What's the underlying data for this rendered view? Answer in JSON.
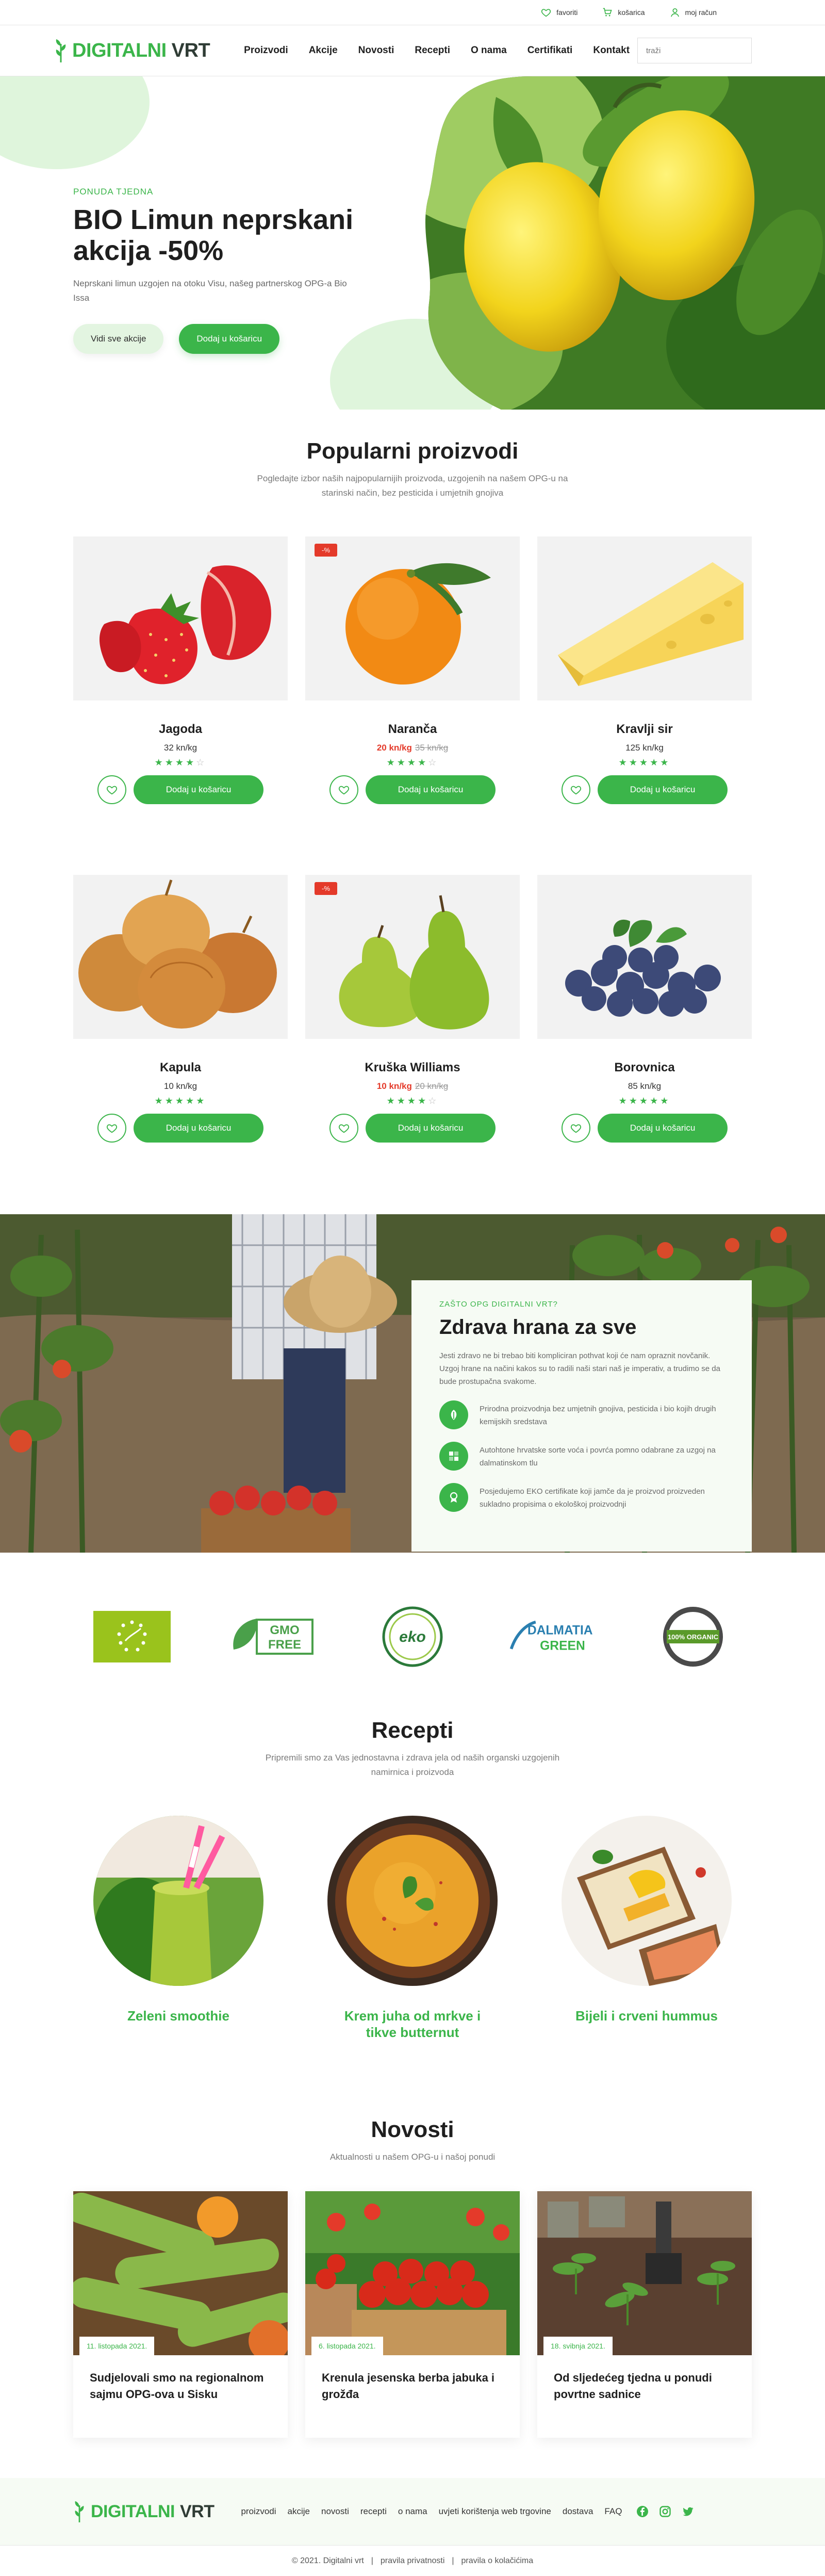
{
  "topbar": {
    "favorites": "favoriti",
    "cart": "košarica",
    "account": "moj račun"
  },
  "header": {
    "logo_a": "DIGITALNI",
    "logo_b": "VRT",
    "nav": [
      "Proizvodi",
      "Akcije",
      "Novosti",
      "Recepti",
      "O nama",
      "Certifikati",
      "Kontakt"
    ],
    "search_placeholder": "traži"
  },
  "hero": {
    "kicker": "PONUDA TJEDNA",
    "title": "BIO Limun neprskani akcija -50%",
    "description": "Neprskani limun uzgojen na otoku Visu, našeg partnerskog OPG-a Bio Issa",
    "btn_all": "Vidi sve akcije",
    "btn_cart": "Dodaj u košaricu"
  },
  "products": {
    "title": "Popularni proizvodi",
    "subtitle": "Pogledajte izbor naših najpopularnijih proizvoda, uzgojenih na našem OPG-u na starinski način, bez pesticida i umjetnih gnojiva",
    "add_label": "Dodaj u košaricu",
    "items": [
      {
        "name": "Jagoda",
        "price": "32 kn/kg",
        "rating": 4
      },
      {
        "name": "Naranča",
        "badge": "-%",
        "price_now": "20 kn/kg",
        "price_old": "35 kn/kg",
        "rating": 4
      },
      {
        "name": "Kravlji sir",
        "price": "125 kn/kg",
        "rating": 5
      },
      {
        "name": "Kapula",
        "price": "10 kn/kg",
        "rating": 5
      },
      {
        "name": "Kruška Williams",
        "badge": "-%",
        "price_now": "10 kn/kg",
        "price_old": "20 kn/kg",
        "rating": 4
      },
      {
        "name": "Borovnica",
        "price": "85 kn/kg",
        "rating": 5
      }
    ]
  },
  "why": {
    "kicker": "ZAŠTO OPG DIGITALNI VRT?",
    "title": "Zdrava hrana za sve",
    "description": "Jesti zdravo ne bi trebao biti kompliciran pothvat koji će nam opraznit novčanik. Uzgoj hrane na načini kakos su to radili naši stari naš je imperativ, a trudimo se da bude prostupačna svakome.",
    "features": [
      "Prirodna proizvodnja bez umjetnih gnojiva, pesticida i bio kojih drugih kemijskih sredstava",
      "Autohtone hrvatske sorte voća i povrća pomno odabrane za uzgoj na dalmatinskom tlu",
      "Posjedujemo EKO certifikate koji jamče da je proizvod proizveden sukladno propisima o ekološkoj proizvodnji"
    ]
  },
  "certs": {
    "gmo_a": "GMO",
    "gmo_b": "FREE",
    "eko": "eko",
    "dalmatia_a": "DALMATIA",
    "dalmatia_b": "GREEN",
    "organic": "100% ORGANIC"
  },
  "recipes": {
    "title": "Recepti",
    "subtitle": "Pripremili smo za Vas jednostavna i zdrava jela od naših organski uzgojenih namirnica i proizvoda",
    "items": [
      "Zeleni smoothie",
      "Krem juha od mrkve i tikve butternut",
      "Bijeli i crveni hummus"
    ]
  },
  "news": {
    "title": "Novosti",
    "subtitle": "Aktualnosti u našem OPG-u i našoj ponudi",
    "items": [
      {
        "date": "11. listopada 2021.",
        "title": "Sudjelovali smo na regionalnom sajmu OPG-ova u Sisku"
      },
      {
        "date": "6. listopada 2021.",
        "title": "Krenula jesenska berba jabuka i grožđa"
      },
      {
        "date": "18. svibnja 2021.",
        "title": "Od sljedećeg tjedna u ponudi povrtne sadnice"
      }
    ]
  },
  "footer": {
    "nav": [
      "proizvodi",
      "akcije",
      "novosti",
      "recepti",
      "o nama",
      "uvjeti korištenja web trgovine",
      "dostava",
      "FAQ"
    ],
    "copyright": "© 2021. Digitalni vrt",
    "privacy": "pravila privatnosti",
    "cookies": "pravila o kolačićima",
    "separator": "|"
  },
  "colors": {
    "accent": "#3bb54a",
    "sale": "#e43a2a",
    "light_green": "#dff5dc",
    "panel": "#f6fbf4"
  }
}
